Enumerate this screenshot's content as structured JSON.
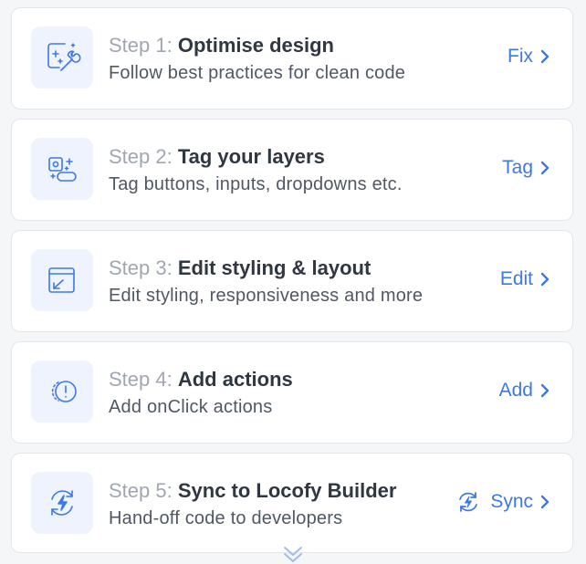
{
  "accent_color": "#3d79e4",
  "steps": [
    {
      "prefix": "Step 1:",
      "title": "Optimise design",
      "subtitle": "Follow best practices for clean code",
      "action": "Fix",
      "icon": "design-wrench-icon"
    },
    {
      "prefix": "Step 2:",
      "title": "Tag your layers",
      "subtitle": "Tag buttons, inputs, dropdowns etc.",
      "action": "Tag",
      "icon": "tag-layers-icon"
    },
    {
      "prefix": "Step 3:",
      "title": "Edit styling & layout",
      "subtitle": "Edit styling, responsiveness and more",
      "action": "Edit",
      "icon": "edit-layout-icon"
    },
    {
      "prefix": "Step 4:",
      "title": "Add actions",
      "subtitle": "Add onClick actions",
      "action": "Add",
      "icon": "click-actions-icon"
    },
    {
      "prefix": "Step 5:",
      "title": "Sync to Locofy Builder",
      "subtitle": "Hand-off code to developers",
      "action": "Sync",
      "icon": "sync-bolt-icon"
    }
  ]
}
